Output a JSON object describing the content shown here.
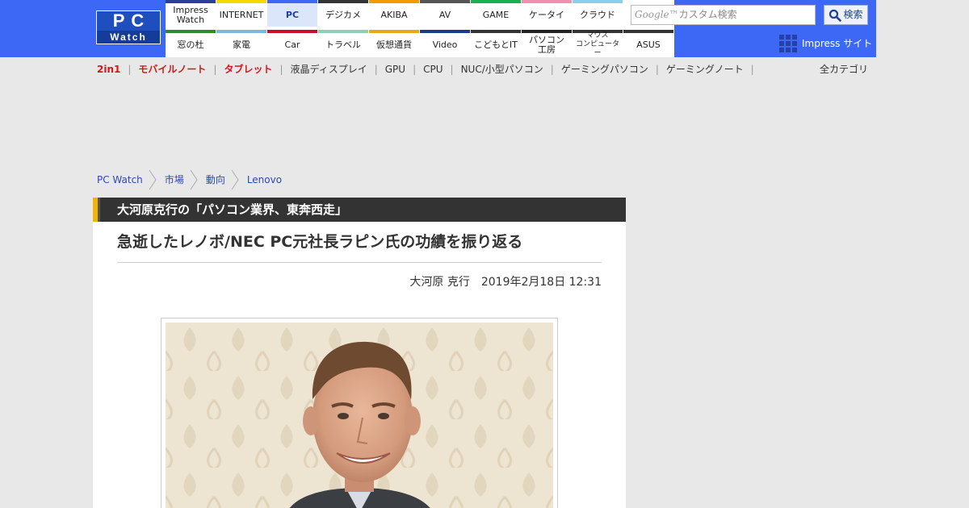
{
  "logo": {
    "line1": "PC",
    "line2": "Watch"
  },
  "site_nav": {
    "row1": [
      {
        "label": "Impress\nWatch",
        "color": "#2a3f9a",
        "active": false
      },
      {
        "label": "INTERNET",
        "color": "#f5d800",
        "active": false
      },
      {
        "label": "PC",
        "color": "#3d68f5",
        "active": true
      },
      {
        "label": "デジカメ",
        "color": "#333333",
        "active": false
      },
      {
        "label": "AKIBA",
        "color": "#f29b00",
        "active": false
      },
      {
        "label": "AV",
        "color": "#555555",
        "active": false
      },
      {
        "label": "GAME",
        "color": "#18b050",
        "active": false
      },
      {
        "label": "ケータイ",
        "color": "#f08fb0",
        "active": false
      },
      {
        "label": "クラウド",
        "color": "#8ad0ec",
        "active": false
      }
    ],
    "row2": [
      {
        "label": "窓の杜",
        "color": "#2e8b2e",
        "active": false
      },
      {
        "label": "家電",
        "color": "#7ab8e0",
        "active": false
      },
      {
        "label": "Car",
        "color": "#c8102e",
        "active": false
      },
      {
        "label": "トラベル",
        "color": "#8dd0b8",
        "active": false
      },
      {
        "label": "仮想通貨",
        "color": "#e8a818",
        "active": false
      },
      {
        "label": "Video",
        "color": "#1a3a8a",
        "active": false
      },
      {
        "label": "こどもとIT",
        "color": "#333333",
        "active": false
      },
      {
        "label": "パソコン\n工房",
        "color": "#222222",
        "active": false
      },
      {
        "label": "マウス\nコンピューター",
        "color": "#333333",
        "active": false,
        "small": true
      },
      {
        "label": "ASUS",
        "color": "#333333",
        "active": false
      }
    ]
  },
  "search": {
    "brand": "Google™",
    "placeholder": "カスタム検索",
    "button_label": "検索"
  },
  "impress_link": "Impress サイト",
  "category_bar": {
    "items": [
      {
        "label": "2in1",
        "highlight": true
      },
      {
        "label": "モバイルノート",
        "highlight": true
      },
      {
        "label": "タブレット",
        "highlight": true
      },
      {
        "label": "液晶ディスプレイ",
        "highlight": false
      },
      {
        "label": "GPU",
        "highlight": false
      },
      {
        "label": "CPU",
        "highlight": false
      },
      {
        "label": "NUC/小型パソコン",
        "highlight": false
      },
      {
        "label": "ゲーミングパソコン",
        "highlight": false
      },
      {
        "label": "ゲーミングノート",
        "highlight": false
      }
    ],
    "separator": "|",
    "all_label": "全カテゴリ"
  },
  "breadcrumb": [
    "PC Watch",
    "市場",
    "動向",
    "Lenovo"
  ],
  "article": {
    "series": "大河原克行の「パソコン業界、東奔西走」",
    "title": "急逝したレノボ/NEC PC元社長ラピン氏の功績を振り返る",
    "author": "大河原 克行",
    "date": "2019年2月18日 12:31"
  },
  "colors": {
    "header_blue": "#3d68f5",
    "accent_red": "#d8141b",
    "link_blue": "#2a4ab0",
    "series_bar": "#333333",
    "series_accent": "#f2b400"
  }
}
